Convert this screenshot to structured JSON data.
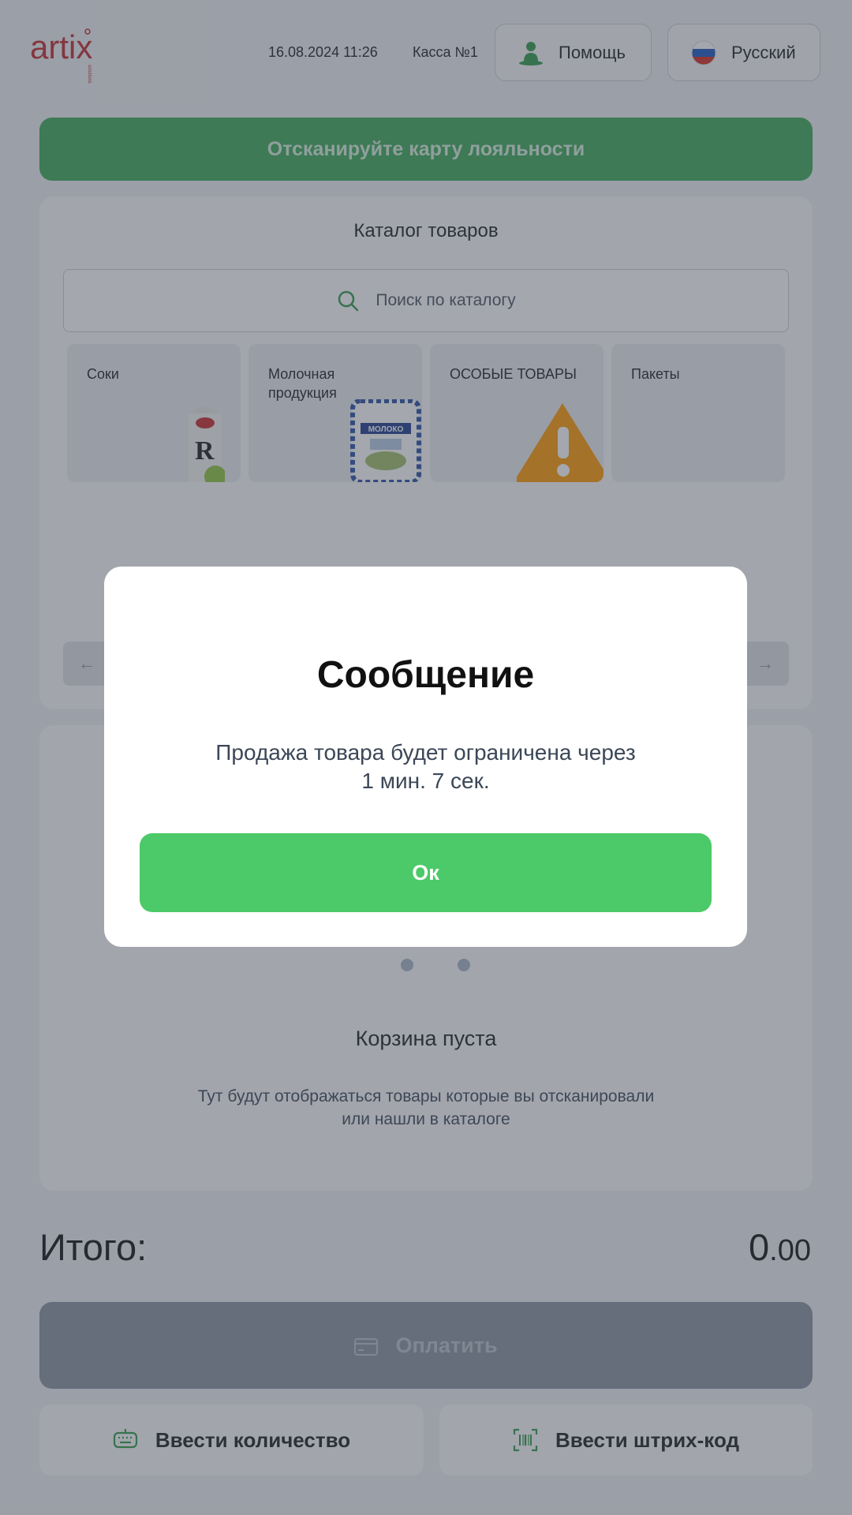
{
  "header": {
    "logo_text": "artix",
    "logo_subtext": "solutions",
    "datetime": "16.08.2024 11:26",
    "register": "Касса №1",
    "help_label": "Помощь",
    "language_label": "Русский",
    "help_icon": "person-support-icon",
    "language_icon": "russia-flag-icon"
  },
  "loyalty": {
    "label": "Отсканируйте карту лояльности"
  },
  "catalog": {
    "title": "Каталог товаров",
    "search_placeholder": "Поиск по каталогу",
    "categories": [
      {
        "label": "Соки"
      },
      {
        "label": "Молочная продукция"
      },
      {
        "label": "ОСОБЫЕ ТОВАРЫ"
      },
      {
        "label": "Пакеты"
      }
    ],
    "juice_brand": "R",
    "milk_pack_text": "МОЛОКО"
  },
  "cart": {
    "title": "Корзина пуста",
    "subtitle_line1": "Тут будут отображаться товары которые вы отсканировали",
    "subtitle_line2": "или нашли в каталоге"
  },
  "totals": {
    "label": "Итого:",
    "int": "0",
    "dec": ".00"
  },
  "actions": {
    "pay_label": "Оплатить",
    "quantity_label": "Ввести количество",
    "barcode_label": "Ввести штрих-код"
  },
  "modal": {
    "title": "Сообщение",
    "message_line1": "Продажа товара будет ограничена через",
    "message_line2": "1 мин. 7 сек.",
    "ok_label": "Ок"
  },
  "colors": {
    "accent_green": "#4cc968",
    "loyalty_green": "#3aa957",
    "brand_red": "#c1272d"
  }
}
